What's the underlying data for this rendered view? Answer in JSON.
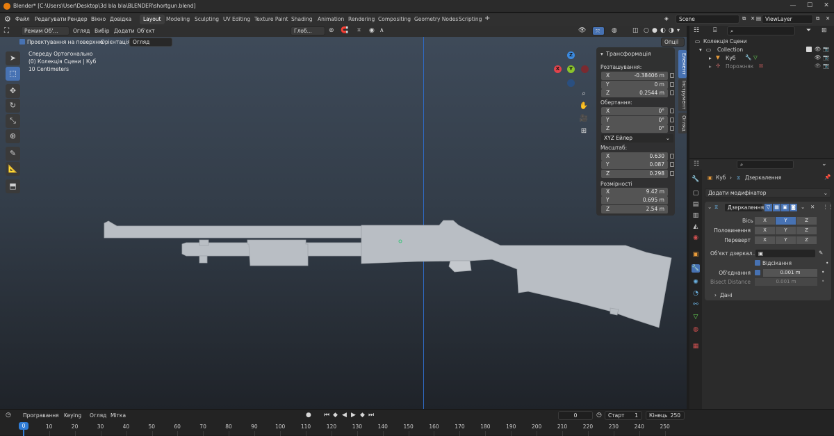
{
  "window": {
    "title": "Blender* [C:\\Users\\User\\Desktop\\3d bla bla\\BLENDER\\shortgun.blend]"
  },
  "menu": {
    "items": [
      "Файл",
      "Редагувати",
      "Рендер",
      "Вікно",
      "Довідка"
    ]
  },
  "workspaces": [
    "Layout",
    "Modeling",
    "Sculpting",
    "UV Editing",
    "Texture Paint",
    "Shading",
    "Animation",
    "Rendering",
    "Compositing",
    "Geometry Nodes",
    "Scripting"
  ],
  "scene": {
    "name": "Scene",
    "viewlayer": "ViewLayer"
  },
  "vpheader": {
    "mode": "Режим Об'...",
    "view": "Огляд",
    "select": "Вибір",
    "add": "Додати",
    "object": "Об'єкт",
    "transform_orientation": "Глоб...",
    "options": "Опції"
  },
  "tool_settings": {
    "project_label": "Проектування на поверхню",
    "orientation_label": "Орієнтація:",
    "orientation_value": "Огляд"
  },
  "overlay": {
    "line1": "Спереду Ортогонально",
    "line2": "(0) Колекція Сцени | Куб",
    "line3": "10 Centimeters"
  },
  "gizmo": {
    "z": "Z",
    "y": "Y",
    "x": "X"
  },
  "npanel": {
    "title": "Трансформація",
    "location_label": "Розташування:",
    "location": [
      {
        "axis": "X",
        "value": "-0.38406 m"
      },
      {
        "axis": "Y",
        "value": "0 m"
      },
      {
        "axis": "Z",
        "value": "0.2544 m"
      }
    ],
    "rotation_label": "Обертання:",
    "rotation": [
      {
        "axis": "X",
        "value": "0°"
      },
      {
        "axis": "Y",
        "value": "0°"
      },
      {
        "axis": "Z",
        "value": "0°"
      }
    ],
    "rotation_mode": "XYZ Ейлер",
    "scale_label": "Масштаб:",
    "scale": [
      {
        "axis": "X",
        "value": "0.630"
      },
      {
        "axis": "Y",
        "value": "0.087"
      },
      {
        "axis": "Z",
        "value": "0.298"
      }
    ],
    "dims_label": "Розмірності",
    "dims": [
      {
        "axis": "X",
        "value": "9.42 m"
      },
      {
        "axis": "Y",
        "value": "0.695 m"
      },
      {
        "axis": "Z",
        "value": "2.54 m"
      }
    ]
  },
  "side_tabs": [
    "Елемент",
    "Інструмент",
    "Огляд"
  ],
  "outliner": {
    "rows": [
      "Колекція Сцени",
      "Collection",
      "Куб",
      "Порожняк"
    ]
  },
  "properties": {
    "breadcrumb_obj": "Куб",
    "breadcrumb_mod": "Дзеркалення",
    "add_modifier": "Додати модифікатор",
    "mod_name": "Дзеркалення",
    "axis_label": "Вісь",
    "bisect_label": "Половинення",
    "flip_label": "Переверт",
    "xyz": [
      "X",
      "Y",
      "Z"
    ],
    "mirror_object_label": "Об'єкт дзеркал...",
    "clipping_label": "Відсікання",
    "merge_label": "Об'єднання",
    "merge_value": "0.001 m",
    "bisect_distance_label": "Bisect Distance",
    "bisect_distance_value": "0.001 m",
    "data_label": "Дані"
  },
  "timeline": {
    "playback": "Програвання",
    "keying": "Keying",
    "view": "Огляд",
    "marker": "Мітка",
    "current_frame": "0",
    "start_label": "Старт",
    "start": "1",
    "end_label": "Кінець",
    "end": "250",
    "ticks": [
      "0",
      "10",
      "20",
      "30",
      "40",
      "50",
      "60",
      "70",
      "80",
      "90",
      "100",
      "110",
      "120",
      "130",
      "140",
      "150",
      "160",
      "170",
      "180",
      "190",
      "200",
      "210",
      "220",
      "230",
      "240",
      "250"
    ]
  },
  "colors": {
    "accent": "#4772b3",
    "model": "#b9bec4",
    "x_axis": "#e2434b",
    "y_axis": "#8bc42b",
    "z_axis": "#3b8ae0"
  }
}
